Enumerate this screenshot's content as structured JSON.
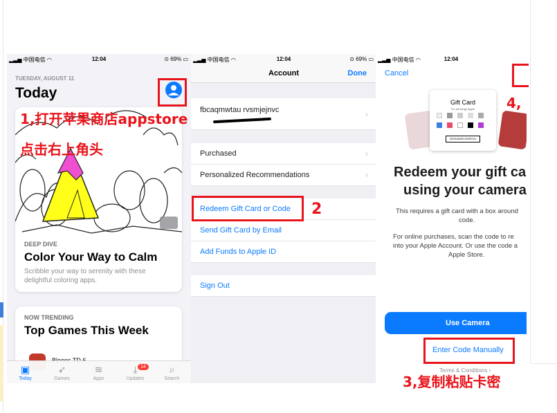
{
  "status": {
    "carrier": "中国电信",
    "time": "12:04",
    "battery": "69%"
  },
  "today": {
    "date": "TUESDAY, AUGUST 11",
    "title": "Today",
    "card1": {
      "eyebrow": "DEEP DIVE",
      "title": "Color Your Way to Calm",
      "desc": "Scribble your way to serenity with these delightful coloring apps."
    },
    "card2": {
      "eyebrow": "NOW TRENDING",
      "title": "Top Games This Week",
      "app": "Bloons TD 6"
    },
    "tabs": [
      {
        "label": "Today",
        "icon": "today-icon"
      },
      {
        "label": "Games",
        "icon": "rocket-icon"
      },
      {
        "label": "Apps",
        "icon": "layers-icon"
      },
      {
        "label": "Updates",
        "icon": "download-icon",
        "badge": "14"
      },
      {
        "label": "Search",
        "icon": "search-icon"
      }
    ]
  },
  "account": {
    "title": "Account",
    "done": "Done",
    "user": "fbcaqmwtau rvsmjejnvc",
    "purchased": "Purchased",
    "recommendations": "Personalized Recommendations",
    "redeem": "Redeem Gift Card or Code",
    "send": "Send Gift Card by Email",
    "add_funds": "Add Funds to Apple ID",
    "sign_out": "Sign Out"
  },
  "redeem": {
    "cancel": "Cancel",
    "card_brand": "Gift Card",
    "card_sub": "For all things Apple",
    "card_code": "XEHZVAWPLYEWPXXX",
    "heading1": "Redeem your gift ca",
    "heading2": "using your camera",
    "para1": "This requires a gift card with a box around",
    "para1b": "code.",
    "para2": "For online purchases, scan the code to re",
    "para2b": "into your Apple Account. Or use the code a",
    "para2c": "Apple Store.",
    "use_camera": "Use Camera",
    "enter_manually": "Enter Code Manually",
    "terms": "Terms & Conditions ›"
  },
  "annotations": {
    "step1a": "1,打开苹果商店appstore",
    "step1b": "点击右上角头",
    "step2": "2",
    "step3": "3,复制粘贴卡密",
    "step4": "4,"
  },
  "colors": {
    "ios_blue": "#0a7aff",
    "annotation_red": "#e8141b"
  }
}
